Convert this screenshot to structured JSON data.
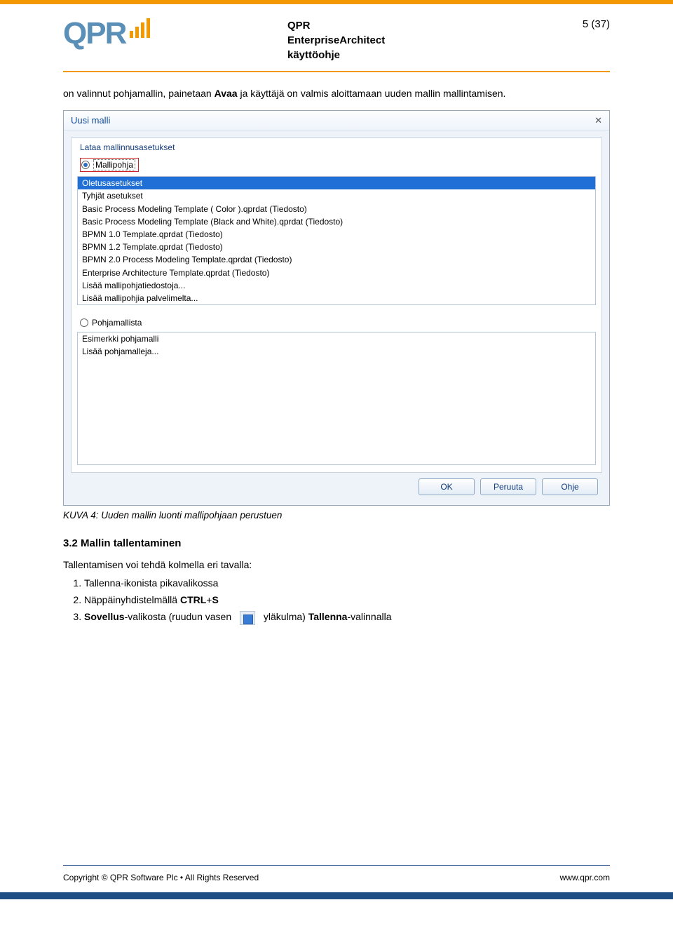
{
  "header": {
    "logo_text": "QPR",
    "title_line1": "QPR",
    "title_line2": "EnterpriseArchitect",
    "title_line3": "käyttöohje",
    "page_num": "5 (37)"
  },
  "intro": {
    "pre": "on valinnut pohjamallin, painetaan ",
    "bold": "Avaa",
    "post": " ja käyttäjä on valmis aloittamaan uuden mallin mallintamisen."
  },
  "dialog": {
    "title": "Uusi malli",
    "group_title": "Lataa mallinnusasetukset",
    "radio1_label": "Mallipohja",
    "list1": [
      "Oletusasetukset",
      "Tyhjät asetukset",
      "Basic Process Modeling Template ( Color ).qprdat (Tiedosto)",
      "Basic Process Modeling Template (Black and White).qprdat (Tiedosto)",
      "BPMN 1.0 Template.qprdat (Tiedosto)",
      "BPMN 1.2 Template.qprdat (Tiedosto)",
      "BPMN 2.0 Process Modeling Template.qprdat (Tiedosto)",
      "Enterprise Architecture Template.qprdat (Tiedosto)",
      "Lisää mallipohjatiedostoja...",
      "Lisää mallipohjia palvelimelta..."
    ],
    "radio2_label": "Pohjamallista",
    "list2": [
      "Esimerkki pohjamalli",
      "Lisää pohjamalleja..."
    ],
    "btn_ok": "OK",
    "btn_cancel": "Peruuta",
    "btn_help": "Ohje"
  },
  "caption": "KUVA 4: Uuden mallin luonti mallipohjaan perustuen",
  "section_heading": "3.2 Mallin tallentaminen",
  "section_intro": "Tallentamisen voi tehdä kolmella eri tavalla:",
  "steps": {
    "s1": "Tallenna-ikonista pikavalikossa",
    "s2_pre": "Näppäinyhdistelmällä ",
    "s2_b1": "CTRL",
    "s2_plus": "+",
    "s2_b2": "S",
    "s3_b1": "Sovellus",
    "s3_mid1": "-valikosta (ruudun vasen",
    "s3_mid2": "yläkulma) ",
    "s3_b2": "Tallenna",
    "s3_tail": "-valinnalla"
  },
  "footer": {
    "left": "Copyright © QPR Software Plc • All Rights Reserved",
    "right": "www.qpr.com"
  }
}
